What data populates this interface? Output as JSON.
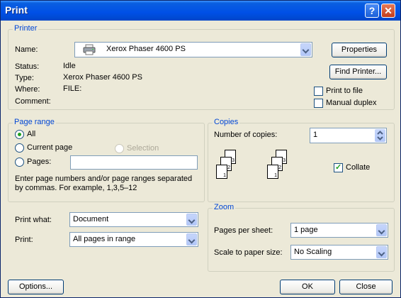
{
  "window": {
    "title": "Print",
    "help_glyph": "?",
    "close_glyph": "✕"
  },
  "printer": {
    "group_label": "Printer",
    "name_label": "Name:",
    "name_value": "Xerox Phaser 4600 PS",
    "properties_button": "Properties",
    "find_printer_button": "Find Printer...",
    "status_label": "Status:",
    "status_value": "Idle",
    "type_label": "Type:",
    "type_value": "Xerox Phaser 4600 PS",
    "where_label": "Where:",
    "where_value": "FILE:",
    "comment_label": "Comment:",
    "comment_value": "",
    "print_to_file": {
      "label": "Print to file",
      "checked": false
    },
    "manual_duplex": {
      "label": "Manual duplex",
      "checked": false
    }
  },
  "page_range": {
    "group_label": "Page range",
    "all_label": "All",
    "current_page_label": "Current page",
    "selection_label": "Selection",
    "pages_label": "Pages:",
    "pages_value": "",
    "selected": "All",
    "hint": "Enter page numbers and/or page ranges separated by commas.  For example, 1,3,5–12"
  },
  "copies": {
    "group_label": "Copies",
    "number_label": "Number of copies:",
    "number_value": "1",
    "collate": {
      "label": "Collate",
      "checked": true
    }
  },
  "print_what": {
    "label": "Print what:",
    "value": "Document"
  },
  "print": {
    "label": "Print:",
    "value": "All pages in range"
  },
  "zoom": {
    "group_label": "Zoom",
    "pages_per_sheet_label": "Pages per sheet:",
    "pages_per_sheet_value": "1 page",
    "scale_label": "Scale to paper size:",
    "scale_value": "No Scaling"
  },
  "footer": {
    "options_button": "Options...",
    "ok_button": "OK",
    "close_button": "Close"
  },
  "colors": {
    "title_bar": "#0054e3",
    "dialog_bg": "#ece9d8",
    "group_label": "#0046d5",
    "check_green": "#21a121"
  },
  "icons": [
    "help-icon",
    "close-icon",
    "printer-icon",
    "dropdown-arrow-icon",
    "spin-arrows-icon",
    "collate-pages-icon"
  ]
}
